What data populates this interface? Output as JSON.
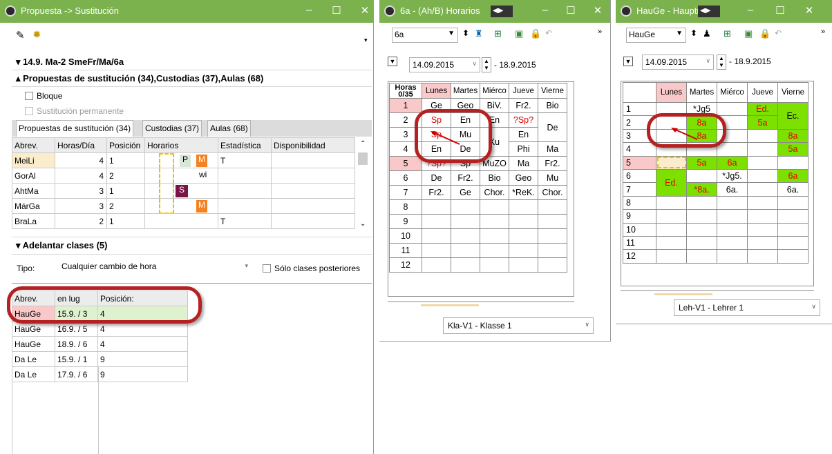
{
  "win1": {
    "title": "Propuesta -> Sustitución",
    "lesson": "14.9. Ma-2 SmeFr/Ma/6a",
    "proposals_header": "Propuestas de sustitución (34),Custodias (37),Aulas (68)",
    "bloque": "Bloque",
    "permanente": "Sustitución permanente",
    "tabs": [
      "Propuestas de sustitución (34)",
      "Custodias (37)",
      "Aulas (68)"
    ],
    "cols": [
      "Abrev.",
      "Horas/Día",
      "Posición",
      "Horarios",
      "Estadística",
      "Disponibilidad"
    ],
    "rows": [
      [
        "MeiLi",
        "4",
        "1",
        "",
        "T"
      ],
      [
        "GorAl",
        "4",
        "2",
        "",
        "wi"
      ],
      [
        "AhtMa",
        "3",
        "1",
        "",
        ""
      ],
      [
        "MárGa",
        "3",
        "2",
        "",
        ""
      ],
      [
        "BraLa",
        "2",
        "1",
        "T",
        ""
      ]
    ],
    "sched": {
      "p": "P",
      "m": "M",
      "s": "S"
    },
    "adelantar": "Adelantar clases (5)",
    "tipo_label": "Tipo:",
    "tipo_value": "Cualquier cambio de hora",
    "solo": "Sólo clases posteriores",
    "mv_cols": [
      "Abrev.",
      "en lug",
      "Posición:"
    ],
    "mv_rows": [
      [
        "HauGe",
        "15.9. / 3",
        "4"
      ],
      [
        "HauGe",
        "16.9. / 5",
        "4"
      ],
      [
        "HauGe",
        "18.9. / 6",
        "4"
      ],
      [
        "Da Le",
        "15.9. / 1",
        "9"
      ],
      [
        "Da Le",
        "17.9. / 6",
        "9"
      ]
    ]
  },
  "win2": {
    "title": "6a - (Ah/B) Horarios",
    "class_input": "6a",
    "date": "14.09.2015",
    "date_end": "- 18.9.2015",
    "corner": [
      "Horas",
      "0/35"
    ],
    "days": [
      "Lunes",
      "Martes",
      "Miérco",
      "Jueve",
      "Vierne"
    ],
    "hours": [
      "1",
      "2",
      "3",
      "4",
      "5",
      "6",
      "7",
      "8",
      "9",
      "10",
      "11",
      "12"
    ],
    "cells": {
      "r1": [
        "Ge",
        "Geo",
        "BiV.",
        "Fr2.",
        "Bio"
      ],
      "r2": [
        "Sp",
        "En",
        "En",
        "?Sp?",
        "De"
      ],
      "r3": [
        "Sp",
        "Mu",
        "Ku",
        "En",
        ""
      ],
      "r4": [
        "En",
        "De",
        "",
        "Phi",
        "Ma"
      ],
      "r5": [
        "?Sp?",
        "Sp",
        "MuZO",
        "Ma",
        "Fr2."
      ],
      "r6": [
        "De",
        "Fr2.",
        "Bio",
        "Geo",
        "Mu"
      ],
      "r7": [
        "Fr2.",
        "Ge",
        "Chor.",
        "*ReK.",
        "Chor."
      ]
    },
    "footer": "Kla-V1 - Klasse 1"
  },
  "win3": {
    "title": "HauGe - Hauptman",
    "teacher_input": "HauGe",
    "date": "14.09.2015",
    "date_end": "- 18.9.2015",
    "days": [
      "Lunes",
      "Martes",
      "Miérco",
      "Jueve",
      "Vierne"
    ],
    "hours": [
      "1",
      "2",
      "3",
      "4",
      "5",
      "6",
      "7",
      "8",
      "9",
      "10",
      "11",
      "12"
    ],
    "cells": {
      "jg5": "*Jg5",
      "ed": "Ed.",
      "ec": "Ec.",
      "a8": "8a",
      "a5": "5a",
      "jg5b": "*Jg5.",
      "ed2": "Ed.",
      "a8b": "*8a.",
      "a6": "6a.",
      "a6b": "6a"
    },
    "footer": "Leh-V1 - Lehrer 1"
  },
  "colors": {
    "titlebar": "#7bb24e",
    "highlight": "#b52020",
    "green": "#7ce000",
    "pink": "#f9c8c8",
    "orange": "#f58220",
    "purple": "#7a1548"
  }
}
